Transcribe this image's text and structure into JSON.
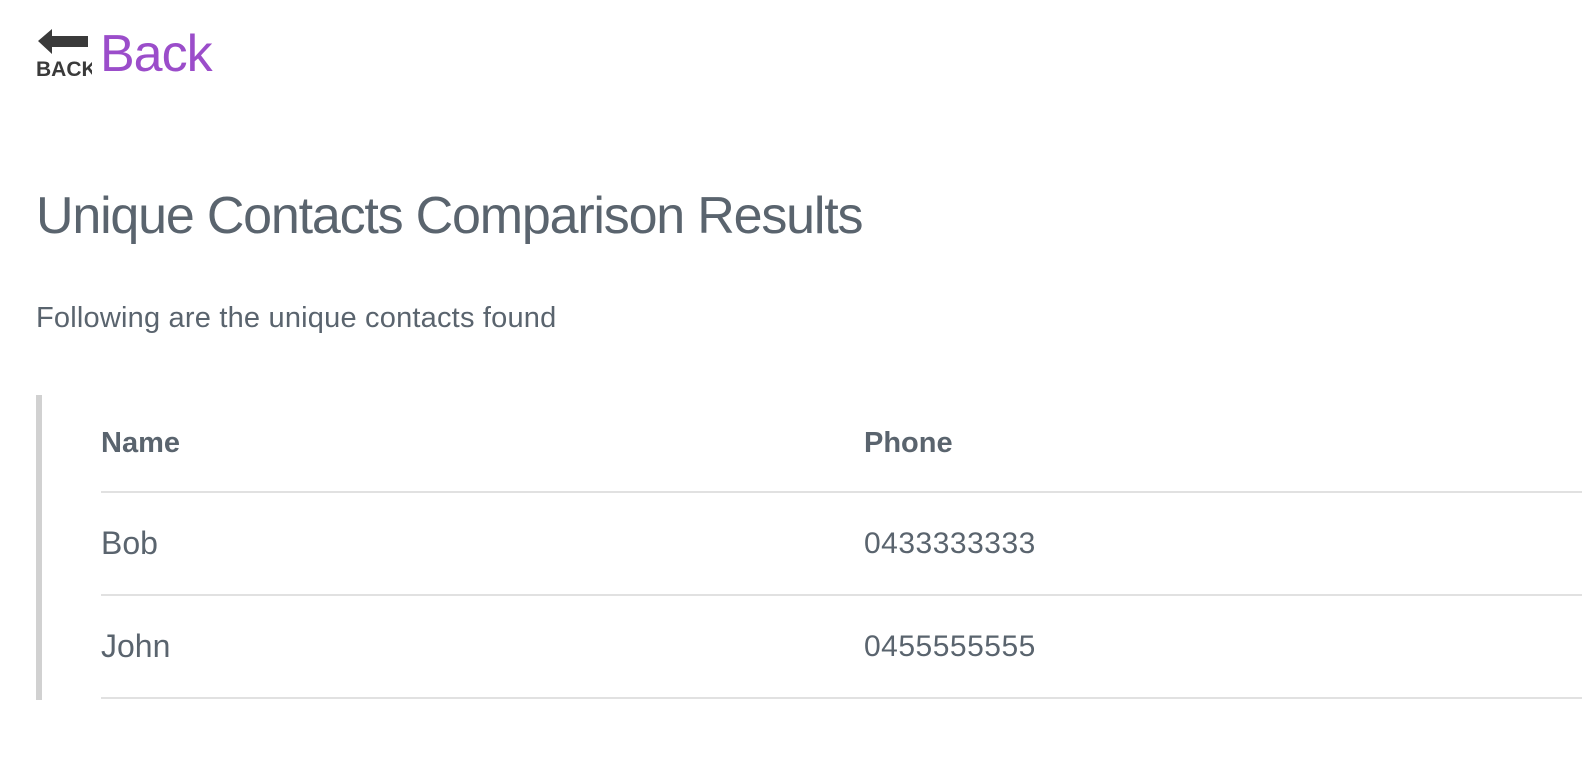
{
  "back": {
    "icon_text": "BACK",
    "label": "Back",
    "color": "#9b4dca"
  },
  "page": {
    "title": "Unique Contacts Comparison Results",
    "subtitle": "Following are the unique contacts found"
  },
  "table": {
    "columns": [
      "Name",
      "Phone"
    ],
    "rows": [
      {
        "name": "Bob",
        "phone": "0433333333"
      },
      {
        "name": "John",
        "phone": "0455555555"
      }
    ]
  }
}
